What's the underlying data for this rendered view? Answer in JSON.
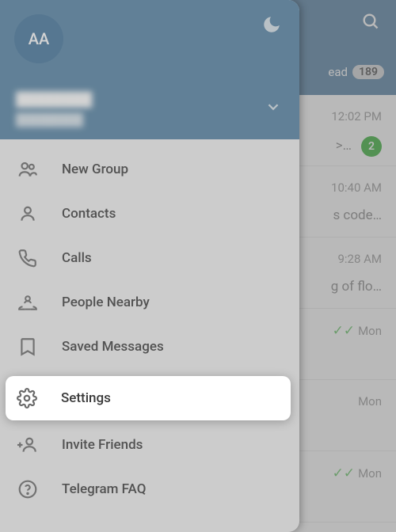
{
  "header": {
    "tab_label": "ead",
    "badge": "189"
  },
  "chats": [
    {
      "time": "12:02 PM",
      "preview": ">…",
      "unread": "2",
      "checks": false
    },
    {
      "time": "10:40 AM",
      "preview": "s code…",
      "unread": null,
      "checks": false
    },
    {
      "time": "9:28 AM",
      "preview": "g of flo…",
      "unread": null,
      "checks": false
    },
    {
      "time": "Mon",
      "preview": "",
      "unread": null,
      "checks": true
    },
    {
      "time": "Mon",
      "preview": "",
      "unread": null,
      "checks": false
    },
    {
      "time": "Mon",
      "preview": "",
      "unread": null,
      "checks": true
    }
  ],
  "drawer": {
    "avatar_initials": "AA",
    "user_name": "████████",
    "user_phone": "████████"
  },
  "menu": [
    {
      "icon": "group",
      "label": "New Group"
    },
    {
      "icon": "person",
      "label": "Contacts"
    },
    {
      "icon": "phone",
      "label": "Calls"
    },
    {
      "icon": "nearby",
      "label": "People Nearby"
    },
    {
      "icon": "bookmark",
      "label": "Saved Messages"
    },
    {
      "icon": "gear",
      "label": "Settings"
    },
    {
      "icon": "invite",
      "label": "Invite Friends"
    },
    {
      "icon": "help",
      "label": "Telegram FAQ"
    }
  ]
}
